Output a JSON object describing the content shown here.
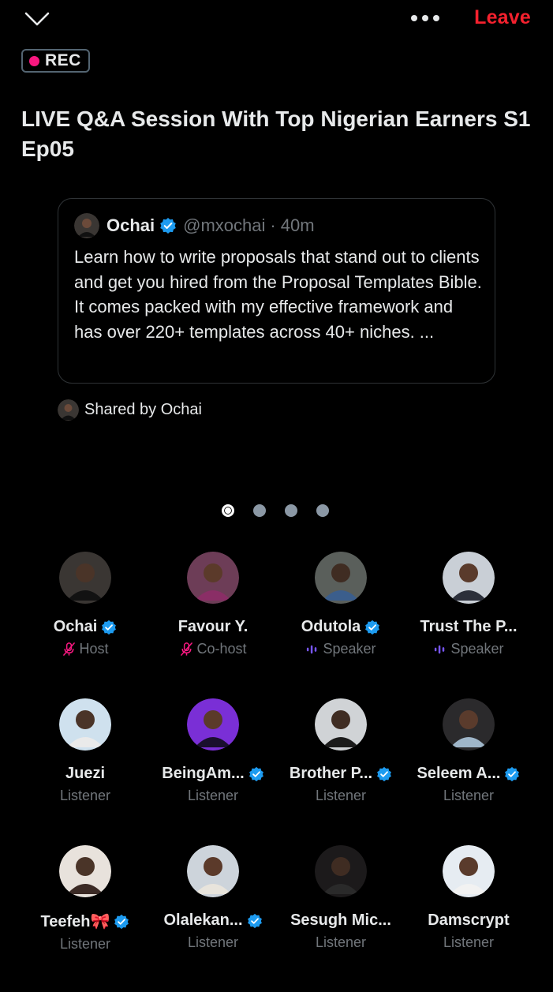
{
  "topbar": {
    "leave_label": "Leave"
  },
  "rec_label": "REC",
  "space_title": "LIVE Q&A Session With Top Nigerian Earners S1 Ep05",
  "tweet": {
    "name": "Ochai",
    "handle": "@mxochai",
    "separator": "·",
    "time": "40m",
    "body": "Learn how to write proposals that stand out to clients and get you hired from the Proposal Templates Bible. It comes packed with my effective framework and has over 220+ templates across 40+ niches. ..."
  },
  "shared_by": "Shared by Ochai",
  "pagination": {
    "total": 4,
    "active_index": 0
  },
  "participants": [
    {
      "name": "Ochai",
      "verified": true,
      "role": "Host",
      "role_icon": "mic-off-icon",
      "avatar_color": "#3a3633"
    },
    {
      "name": "Favour Y.",
      "verified": false,
      "role": "Co-host",
      "role_icon": "mic-off-icon",
      "avatar_color": "#6d3d57"
    },
    {
      "name": "Odutola",
      "verified": true,
      "role": "Speaker",
      "role_icon": "speaking-bars-icon",
      "avatar_color": "#5a5f5b"
    },
    {
      "name": "Trust The P...",
      "verified": false,
      "role": "Speaker",
      "role_icon": "speaking-bars-icon",
      "avatar_color": "#c9cfd6"
    },
    {
      "name": "Juezi",
      "verified": false,
      "role": "Listener",
      "role_icon": "",
      "avatar_color": "#cfe1ee"
    },
    {
      "name": "BeingAm...",
      "verified": true,
      "role": "Listener",
      "role_icon": "",
      "avatar_color": "#7a2fd6"
    },
    {
      "name": "Brother P...",
      "verified": true,
      "role": "Listener",
      "role_icon": "",
      "avatar_color": "#d0d3d6"
    },
    {
      "name": "Seleem A...",
      "verified": true,
      "role": "Listener",
      "role_icon": "",
      "avatar_color": "#2b2a2c"
    },
    {
      "name": "Teefeh🎀",
      "verified": true,
      "role": "Listener",
      "role_icon": "",
      "avatar_color": "#e8e2dc"
    },
    {
      "name": "Olalekan...",
      "verified": true,
      "role": "Listener",
      "role_icon": "",
      "avatar_color": "#cdd4db"
    },
    {
      "name": "Sesugh Mic...",
      "verified": false,
      "role": "Listener",
      "role_icon": "",
      "avatar_color": "#1c1a1b"
    },
    {
      "name": "Damscrypt",
      "verified": false,
      "role": "Listener",
      "role_icon": "",
      "avatar_color": "#e6ecf2"
    }
  ],
  "colors": {
    "background": "#000000",
    "leave": "#f4212e",
    "rec_dot": "#f91880",
    "verified": "#1d9bf0",
    "host_icon": "#f91880",
    "speaker_icon": "#7856ff",
    "muted_text": "#71767b"
  }
}
